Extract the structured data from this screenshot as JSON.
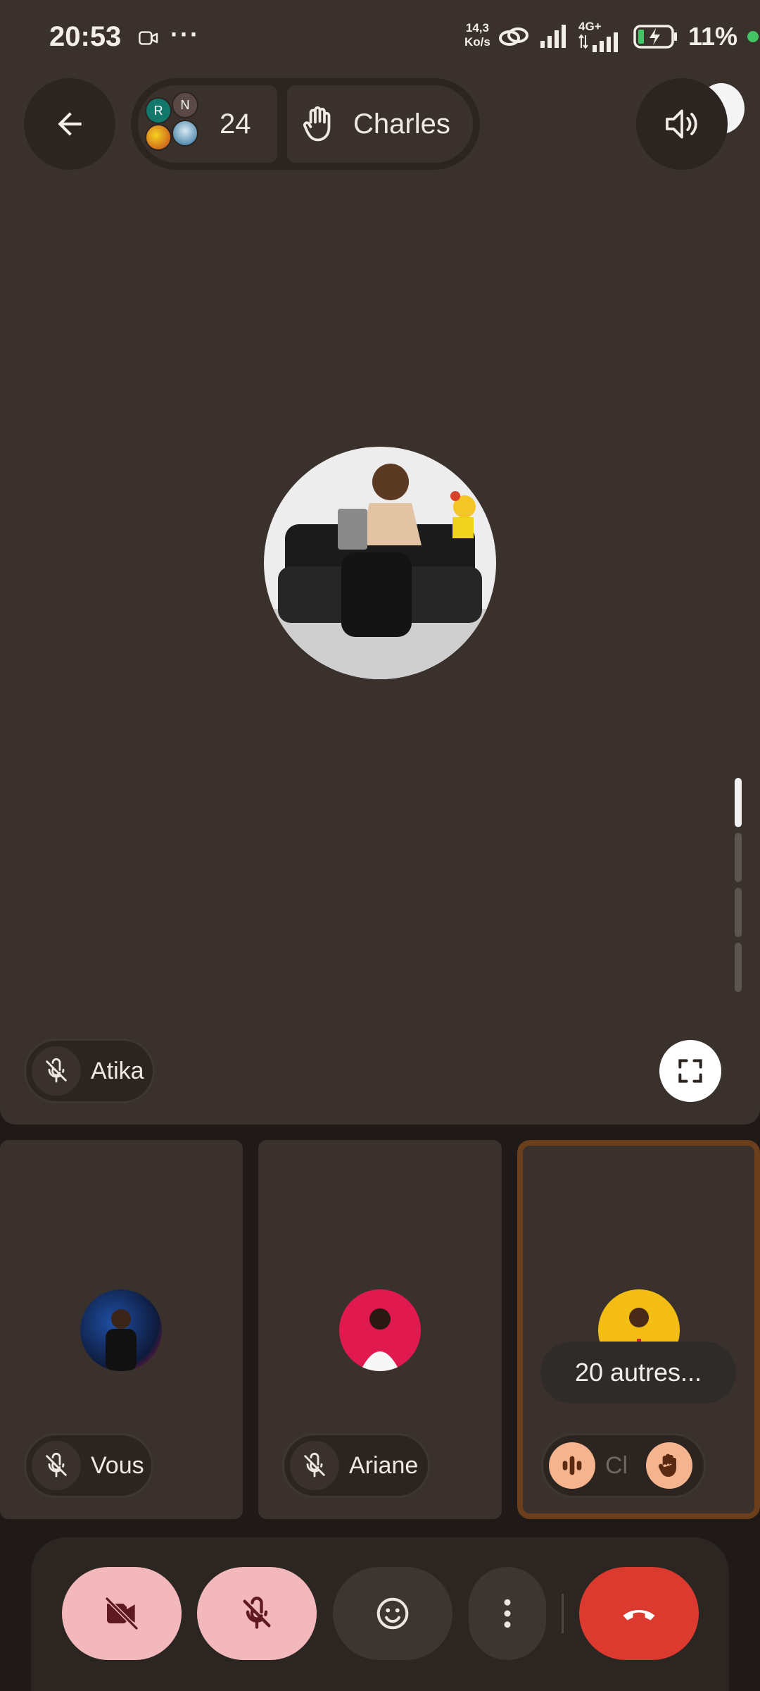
{
  "status_bar": {
    "time": "20:53",
    "net_speed_value": "14,3",
    "net_speed_unit": "Ko/s",
    "network_type": "4G+",
    "battery_percent": "11%"
  },
  "header": {
    "participant_count": "24",
    "avatar_initials": [
      "R",
      "N"
    ],
    "raised_hand_name": "Charles"
  },
  "stage": {
    "speaker_name": "Atika"
  },
  "tiles": [
    {
      "name": "Vous",
      "muted": true
    },
    {
      "name": "Ariane",
      "muted": true
    },
    {
      "name": "Cl",
      "others_label": "20 autres..."
    }
  ],
  "controls": {
    "camera": "camera-off",
    "mic": "mic-off",
    "emoji": "emoji",
    "more": "more",
    "hangup": "end-call"
  },
  "colors": {
    "stage_bg": "#3a312c",
    "pink_button": "#f2b8bb",
    "end_call": "#dc3a2f",
    "highlight_border": "#6b3e1c",
    "hand_accent": "#f5b48d"
  }
}
